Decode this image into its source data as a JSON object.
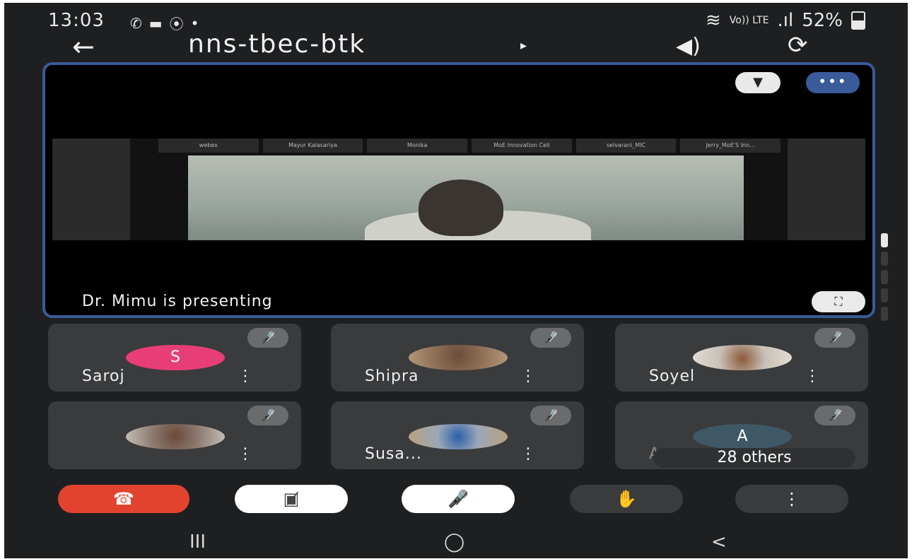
{
  "status_bar": {
    "time": "13:03",
    "left_icons": [
      "whatsapp-icon",
      "video-call-icon",
      "recording-icon",
      "dot-icon"
    ],
    "signal_label": "Vo))\nLTE",
    "battery": "52%"
  },
  "top_bar": {
    "title": "nns-tbec-btk",
    "caret": "▸",
    "back_icon": "back-arrow-icon",
    "speaker_icon": "speaker-icon",
    "switch_camera_icon": "switch-camera-icon"
  },
  "stage": {
    "presenting_label": "Dr. Mimu is presenting",
    "pin_icon": "pin-icon",
    "more_icon": "more-dots-icon",
    "fullscreen_icon": "fullscreen-icon",
    "shared_tabs": [
      "webex",
      "Mayur Kalasariya",
      "Monika",
      "MoE Innovation Cell",
      "selvarani_MIC",
      "Jerry_MoE'S Inn..."
    ]
  },
  "participants": [
    {
      "name": "Saroj",
      "avatar_letter": "S",
      "avatar_color": "#e83e78",
      "muted": true
    },
    {
      "name": "Shipra",
      "avatar_letter": "",
      "avatar_color": "#8a6a52",
      "muted": true
    },
    {
      "name": "Soyel",
      "avatar_letter": "",
      "avatar_color": "#c9c1b7",
      "muted": true
    },
    {
      "name": "",
      "avatar_letter": "",
      "avatar_color": "#8c7a70",
      "muted": true
    },
    {
      "name": "Susa...",
      "avatar_letter": "",
      "avatar_color": "#9aa7b8",
      "muted": true
    },
    {
      "name": "An...",
      "avatar_letter": "A",
      "avatar_color": "#3f5866",
      "muted": true,
      "others_label": "28 others"
    }
  ],
  "controls": {
    "end_call_icon": "end-call-icon",
    "video_off_icon": "video-off-icon",
    "mic_off_icon": "mic-off-icon",
    "raise_hand_icon": "raise-hand-icon",
    "more_icon": "more-vertical-icon"
  },
  "nav_bar": {
    "recents": "III",
    "home": "◯",
    "back": "<"
  },
  "colors": {
    "background": "#1e1f21",
    "tile": "#3a3b3d",
    "stage_border": "#3a5a9a",
    "end_call": "#e2432f"
  }
}
